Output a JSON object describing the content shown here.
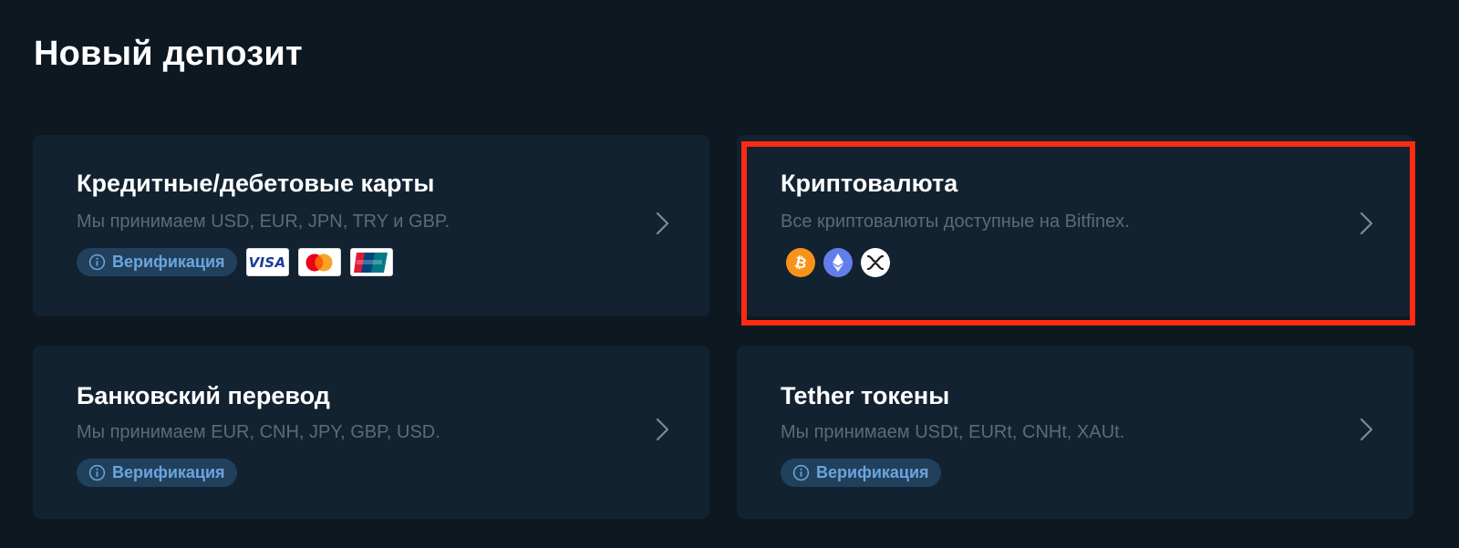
{
  "page": {
    "title": "Новый депозит"
  },
  "cards": [
    {
      "title": "Кредитные/дебетовые карты",
      "description": "Мы принимаем USD, EUR, JPN, TRY и GBP.",
      "verify_label": "Верификация",
      "payment_logos": [
        "VISA",
        "mastercard-logo",
        "unionpay-logo"
      ]
    },
    {
      "title": "Криптовалюта",
      "description": "Все криптовалюты доступные на Bitfinex.",
      "coin_icons": [
        "bitcoin-icon",
        "ethereum-icon",
        "xrp-icon"
      ]
    },
    {
      "title": "Банковский перевод",
      "description": "Мы принимаем EUR, CNH, JPY, GBP, USD.",
      "verify_label": "Верификация"
    },
    {
      "title": "Tether токены",
      "description": "Мы принимаем USDt, EURt, CNHt, XAUt.",
      "verify_label": "Верификация"
    }
  ],
  "colors": {
    "background": "#0d1821",
    "card": "#132230",
    "title": "#ffffff",
    "description": "#5b6b78",
    "badge_bg": "#21405c",
    "badge_text": "#6aa5dd",
    "highlight": "#ff2a12",
    "bitcoin": "#f7931a",
    "ethereum": "#627eea"
  }
}
